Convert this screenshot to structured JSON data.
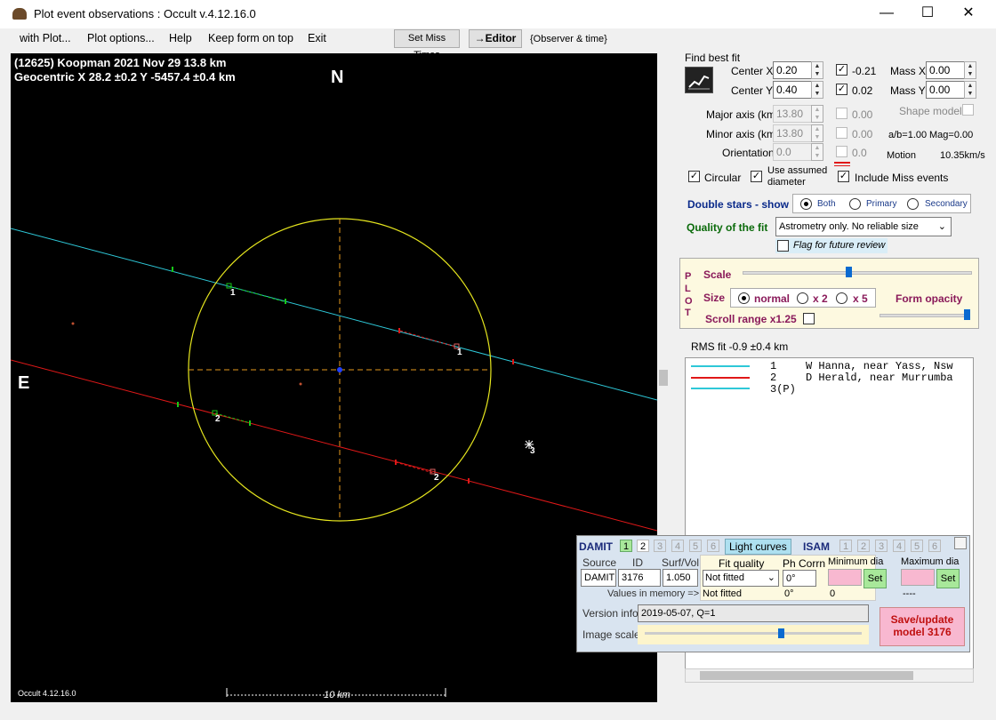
{
  "window": {
    "title": "Plot event observations : Occult v.4.12.16.0"
  },
  "menu": {
    "items": [
      "with Plot...",
      "Plot options...",
      "Help",
      "Keep form on top",
      "Exit"
    ],
    "set_miss_times": "Set Miss Times",
    "editor": "→Editor",
    "observer_time": "{Observer & time}"
  },
  "plot": {
    "header_line1": "(12625) Koopman  2021 Nov 29   13.8 km",
    "header_line2": "Geocentric  X  28.2 ±0.2  Y -5457.4 ±0.4 km",
    "north": "N",
    "east": "E",
    "chord_labels": [
      "1",
      "2",
      "1",
      "2",
      "3"
    ],
    "version": "Occult 4.12.16.0",
    "scale_label": "10 km",
    "colors": {
      "chord1": "#2ec8d8",
      "chord2": "#e01818",
      "ellipse": "#e6e61e",
      "axes": "#e69a1e",
      "miss": "#18c818"
    }
  },
  "fit": {
    "title": "Find best fit",
    "center_x_label": "Center X",
    "center_x": "0.20",
    "center_x_check": "-0.21",
    "center_y_label": "Center Y",
    "center_y": "0.40",
    "center_y_check": "0.02",
    "mass_x_label": "Mass X",
    "mass_x": "0.00",
    "mass_y_label": "Mass Y",
    "mass_y": "0.00",
    "major_label": "Major axis (km)",
    "major": "13.80",
    "major_check": "0.00",
    "minor_label": "Minor axis (km)",
    "minor": "13.80",
    "minor_check": "0.00",
    "orient_label": "Orientation",
    "orient": "0.0",
    "orient_check": "0.0",
    "shape_model": "Shape model",
    "ab": "a/b=1.00",
    "mag": "Mag=0.00",
    "motion_label": "Motion",
    "motion": "10.35km/s",
    "circular": "Circular",
    "use_assumed": "Use assumed",
    "diameter": "diameter",
    "include_miss": "Include Miss events"
  },
  "double_stars": {
    "label": "Double stars - show",
    "both": "Both",
    "primary": "Primary",
    "secondary": "Secondary"
  },
  "quality": {
    "label": "Quality of the fit",
    "value": "Astrometry only. No reliable size",
    "flag": "Flag for future review"
  },
  "plot_panel": {
    "side": [
      "P",
      "L",
      "O",
      "T"
    ],
    "scale": "Scale",
    "size": "Size",
    "normal": "normal",
    "x2": "x 2",
    "x5": "x 5",
    "form_opacity": "Form opacity",
    "scroll_range": "Scroll range x1.25"
  },
  "rms": "RMS fit -0.9 ±0.4 km",
  "legend_rows": [
    {
      "num": "1",
      "text": "W Hanna, near Yass, Nsw",
      "color": "#2ec8d8"
    },
    {
      "num": "2",
      "text": "D Herald, near Murrumba",
      "color": "#e01818"
    },
    {
      "num": "3(P)",
      "text": "",
      "color": "#2ec8d8"
    }
  ],
  "damit": {
    "label": "DAMIT",
    "tabs": [
      "1",
      "2",
      "3",
      "4",
      "5",
      "6"
    ],
    "light_curves": "Light curves",
    "isam": "ISAM",
    "isam_tabs": [
      "1",
      "2",
      "3",
      "4",
      "5",
      "6"
    ],
    "source_h": "Source",
    "id_h": "ID",
    "surf_h": "Surf/Vol",
    "source": "DAMIT",
    "id": "3176",
    "surf": "1.050",
    "fit_quality_h": "Fit quality",
    "ph_corrn_h": "Ph Corrn",
    "min_dia_h": "Minimum dia",
    "max_dia_h": "Maximum dia",
    "fit_quality": "Not fitted",
    "ph_corrn": "0°",
    "values_mem": "Values in memory =>",
    "mem_fit": "Not fitted",
    "mem_ph": "0°",
    "mem_min": "0",
    "mem_max": "----",
    "set": "Set",
    "version_label": "Version info",
    "version": "2019-05-07, Q=1",
    "image_scale": "Image scale",
    "save_line1": "Save/update",
    "save_line2": "model 3176"
  }
}
